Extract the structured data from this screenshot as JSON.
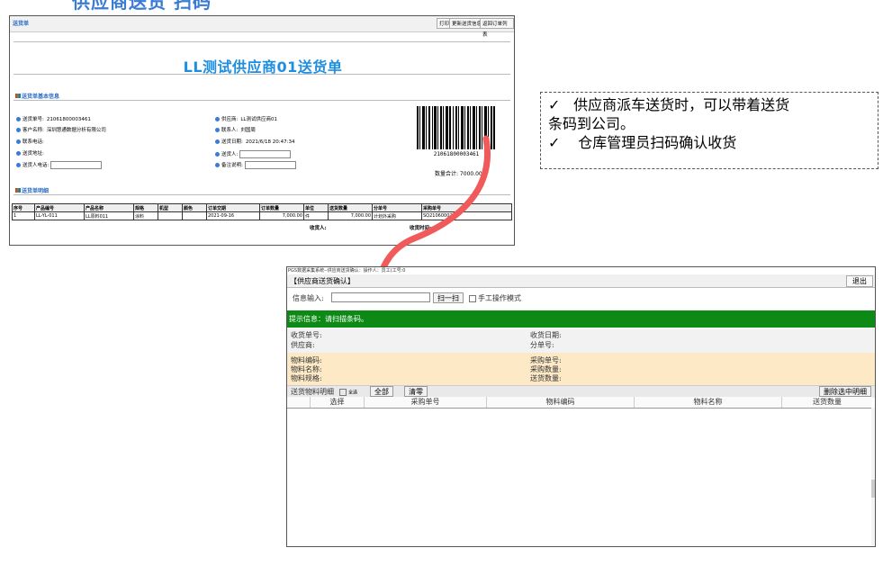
{
  "top_heading": "供应商送货 扫码",
  "delivery_note": {
    "window_title": "送货单",
    "buttons": [
      "打印",
      "更新送货信息",
      "返回订单列表"
    ],
    "title": "LL测试供应商01送货单",
    "section_basic": "送货单基本信息",
    "left_fields": [
      {
        "label": "送货单号:",
        "value": "21061800003461"
      },
      {
        "label": "客户名称:",
        "value": "深圳慧通数据分析有限公司"
      },
      {
        "label": "联系电话:",
        "value": ""
      },
      {
        "label": "送货地址:",
        "value": ""
      },
      {
        "label": "送货人电话:",
        "value": ""
      }
    ],
    "right_fields": [
      {
        "label": "供应商:",
        "value": "LL测试供应商01"
      },
      {
        "label": "联系人:",
        "value": "刘国周"
      },
      {
        "label": "送货日期:",
        "value": "2021/6/18 20:47:34"
      },
      {
        "label": "送货人:",
        "value": ""
      },
      {
        "label": "备注说明:",
        "value": ""
      }
    ],
    "barcode_number": "21061800003461",
    "qty_total": "数量合计: 7000.00",
    "section_detail": "送货单明细",
    "table": {
      "headers": [
        "序号",
        "产品编号",
        "产品名称",
        "规格",
        "机型",
        "颜色",
        "订单交期",
        "订单数量",
        "单位",
        "送货数量",
        "分单号",
        "采购单号"
      ],
      "rows": [
        [
          "1",
          "LL-YL-011",
          "LL原料011",
          "涂料",
          "",
          "",
          "2021-09-16",
          "7,000.00",
          "件",
          "7,000.00",
          "计划外采购",
          "SQ210600025"
        ]
      ],
      "footer_receiver": "收货人:",
      "footer_time": "收货时间:"
    }
  },
  "callout": {
    "check": "✓",
    "lines": [
      "供应商派车送货时，可以带着送货",
      "条码到公司。",
      "仓库管理员扫码确认收货"
    ]
  },
  "confirm_screen": {
    "app_title": "PGS数据采集系统--供应商送货确认：操作人：员工(工号:0",
    "header_title": "【供应商送货确认】",
    "exit_label": "退出",
    "info_input_label": "信息输入:",
    "scan_button": "扫一扫",
    "manual_mode_label": "手工操作模式",
    "tip_text": "提示信息：请扫描条码。",
    "info_left": [
      "收货单号:",
      "供应商:"
    ],
    "info_right": [
      "收货日期:",
      "分单号:"
    ],
    "mat_left": [
      "物料编码:",
      "物料名称:",
      "物料规格:"
    ],
    "mat_right": [
      "采购单号:",
      "采购数量:",
      "送货数量:"
    ],
    "list_title": "送货物料明细",
    "select_all_label": "全选",
    "btn_all": "全部",
    "btn_clear": "清零",
    "btn_delete_selected": "删除选中明细",
    "grid_headers": [
      "选择",
      "采购单号",
      "物料编码",
      "物料名称",
      "送货数量"
    ]
  },
  "colors": {
    "tip_bar": "#0d8a16",
    "material_bg": "#fde9c6",
    "arrow": "#f05a5a",
    "title_blue": "#1e8fe0"
  }
}
